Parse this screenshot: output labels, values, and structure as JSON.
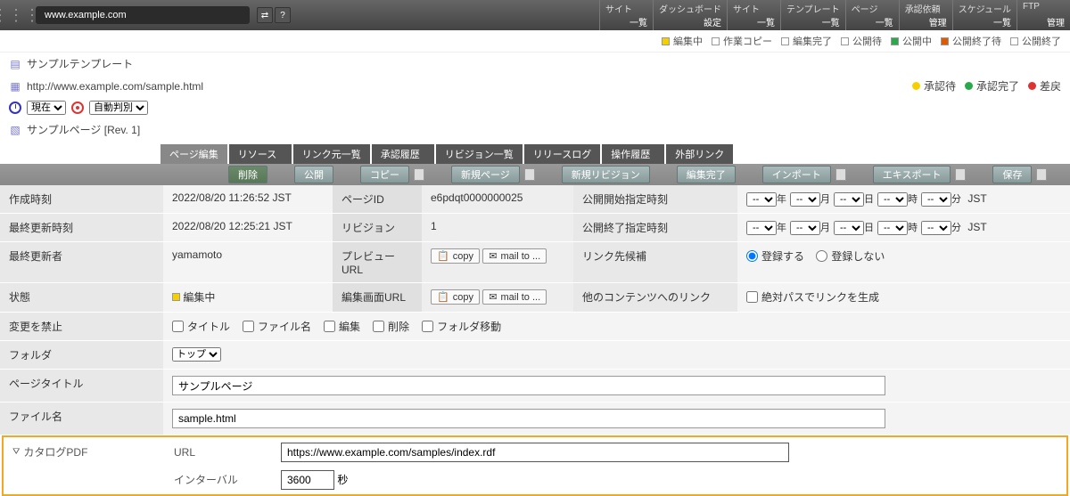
{
  "header": {
    "url": "www.example.com",
    "nav": [
      {
        "title": "サイト",
        "sub": "一覧"
      },
      {
        "title": "ダッシュボード",
        "sub": "設定"
      },
      {
        "title": "サイト",
        "sub": "一覧"
      },
      {
        "title": "テンプレート",
        "sub": "一覧"
      },
      {
        "title": "ページ",
        "sub": "一覧"
      },
      {
        "title": "承認依頼",
        "sub": "管理"
      },
      {
        "title": "スケジュール",
        "sub": "一覧"
      },
      {
        "title": "FTP",
        "sub": "管理"
      }
    ]
  },
  "status_legend_1": [
    {
      "label": "編集中",
      "color": "#f5d000"
    },
    {
      "label": "作業コピー",
      "color": "transparent"
    },
    {
      "label": "編集完了",
      "color": "transparent"
    },
    {
      "label": "公開待",
      "color": "transparent"
    },
    {
      "label": "公開中",
      "color": "#2aa84a"
    },
    {
      "label": "公開終了待",
      "color": "#e05a00"
    },
    {
      "label": "公開終了",
      "color": "transparent"
    }
  ],
  "status_legend_2": [
    {
      "label": "承認待",
      "color": "#f5d000"
    },
    {
      "label": "承認完了",
      "color": "#2aa84a"
    },
    {
      "label": "差戻",
      "color": "#d33"
    }
  ],
  "breadcrumb": {
    "template": "サンプルテンプレート",
    "page_url": "http://www.example.com/sample.html",
    "time_select": "現在",
    "judge_select": "自動判別",
    "revision": "サンプルページ [Rev. 1]"
  },
  "tabs": [
    "ページ編集",
    "リソース",
    "リンク元一覧",
    "承認履歴",
    "リビジョン一覧",
    "リリースログ",
    "操作履歴",
    "外部リンク"
  ],
  "actions": [
    "削除",
    "公開",
    "コピー",
    "新規ページ",
    "新規リビジョン",
    "編集完了",
    "インポート",
    "エキスポート",
    "保存"
  ],
  "fields": {
    "created_label": "作成時刻",
    "created": "2022/08/20 11:26:52 JST",
    "updated_label": "最終更新時刻",
    "updated": "2022/08/20 12:25:21 JST",
    "updater_label": "最終更新者",
    "updater": "yamamoto",
    "state_label": "状態",
    "state": "編集中",
    "pageid_label": "ページID",
    "pageid": "e6pdqt0000000025",
    "rev_label": "リビジョン",
    "rev": "1",
    "preview_label": "プレビューURL",
    "copy": "copy",
    "mailto": "mail to ...",
    "editurl_label": "編集画面URL",
    "pub_start_label": "公開開始指定時刻",
    "pub_end_label": "公開終了指定時刻",
    "link_cand_label": "リンク先候補",
    "reg_yes": "登録する",
    "reg_no": "登録しない",
    "other_link_label": "他のコンテンツへのリンク",
    "abs_path": "絶対パスでリンクを生成",
    "date_units": {
      "y": "年",
      "m": "月",
      "d": "日",
      "h": "時",
      "min": "分",
      "tz": "JST",
      "dash": "--"
    },
    "nochange_label": "変更を禁止",
    "nochange_opts": [
      "タイトル",
      "ファイル名",
      "編集",
      "削除",
      "フォルダ移動"
    ],
    "folder_label": "フォルダ",
    "folder_val": "トップ",
    "title_label": "ページタイトル",
    "title_val": "サンプルページ",
    "file_label": "ファイル名",
    "file_val": "sample.html"
  },
  "catalog": {
    "section": "カタログPDF",
    "url_label": "URL",
    "url_val": "https://www.example.com/samples/index.rdf",
    "interval_label": "インターバル",
    "interval_val": "3600",
    "interval_unit": "秒"
  }
}
